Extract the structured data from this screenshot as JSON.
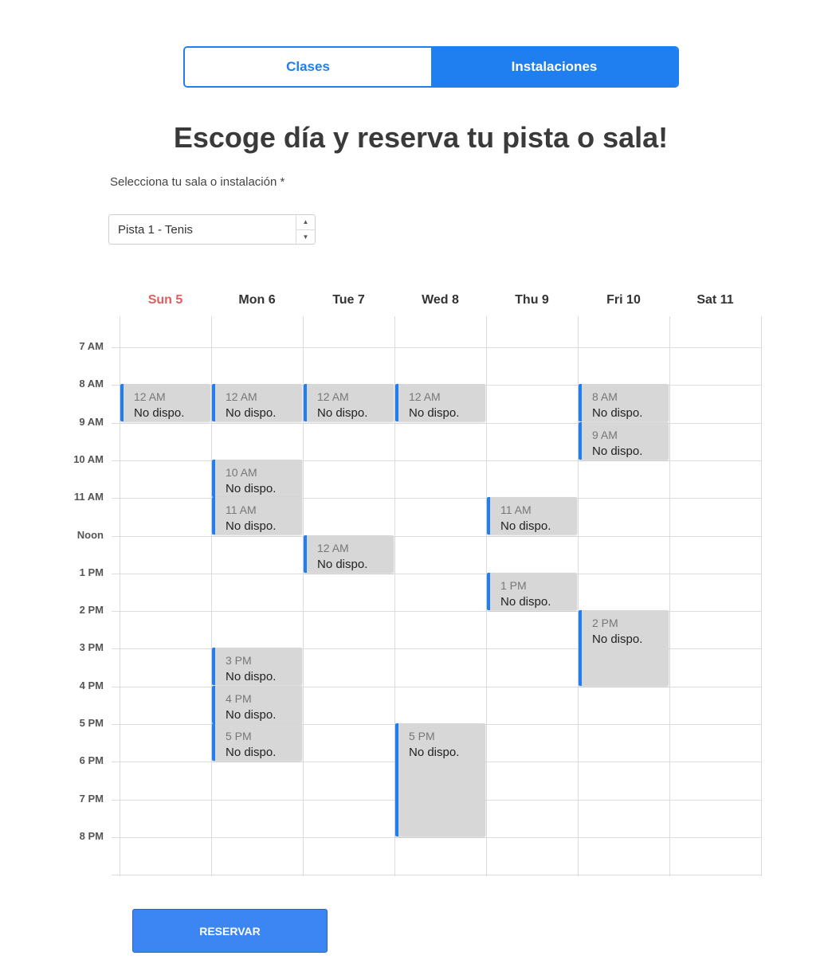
{
  "tabs": [
    {
      "label": "Clases",
      "active": false
    },
    {
      "label": "Instalaciones",
      "active": true
    }
  ],
  "heading": "Escoge día y reserva tu pista o sala!",
  "facility": {
    "label": "Selecciona tu sala o instalación *",
    "selected": "Pista 1 - Tenis"
  },
  "calendar": {
    "days": [
      {
        "label": "Sun 5",
        "today": true
      },
      {
        "label": "Mon 6",
        "today": false
      },
      {
        "label": "Tue 7",
        "today": false
      },
      {
        "label": "Wed 8",
        "today": false
      },
      {
        "label": "Thu 9",
        "today": false
      },
      {
        "label": "Fri 10",
        "today": false
      },
      {
        "label": "Sat 11",
        "today": false
      }
    ],
    "hours": [
      "7 AM",
      "8 AM",
      "9 AM",
      "10 AM",
      "11 AM",
      "Noon",
      "1 PM",
      "2 PM",
      "3 PM",
      "4 PM",
      "5 PM",
      "6 PM",
      "7 PM",
      "8 PM"
    ],
    "events": [
      {
        "day": 0,
        "start": 8,
        "end": 9,
        "time": "12 AM",
        "title": "No dispo."
      },
      {
        "day": 1,
        "start": 8,
        "end": 9,
        "time": "12 AM",
        "title": "No dispo."
      },
      {
        "day": 2,
        "start": 8,
        "end": 9,
        "time": "12 AM",
        "title": "No dispo."
      },
      {
        "day": 3,
        "start": 8,
        "end": 9,
        "time": "12 AM",
        "title": "No dispo."
      },
      {
        "day": 5,
        "start": 8,
        "end": 9,
        "time": "8 AM",
        "title": "No dispo."
      },
      {
        "day": 5,
        "start": 9,
        "end": 10,
        "time": "9 AM",
        "title": "No dispo."
      },
      {
        "day": 1,
        "start": 10,
        "end": 11,
        "time": "10 AM",
        "title": "No dispo."
      },
      {
        "day": 1,
        "start": 11,
        "end": 12,
        "time": "11 AM",
        "title": "No dispo."
      },
      {
        "day": 4,
        "start": 11,
        "end": 12,
        "time": "11 AM",
        "title": "No dispo."
      },
      {
        "day": 2,
        "start": 12,
        "end": 13,
        "time": "12 AM",
        "title": "No dispo."
      },
      {
        "day": 4,
        "start": 13,
        "end": 14,
        "time": "1 PM",
        "title": "No dispo."
      },
      {
        "day": 5,
        "start": 14,
        "end": 16,
        "time": "2 PM",
        "title": "No dispo."
      },
      {
        "day": 1,
        "start": 15,
        "end": 16,
        "time": "3 PM",
        "title": "No dispo."
      },
      {
        "day": 1,
        "start": 16,
        "end": 17,
        "time": "4 PM",
        "title": "No dispo."
      },
      {
        "day": 1,
        "start": 17,
        "end": 18,
        "time": "5 PM",
        "title": "No dispo."
      },
      {
        "day": 3,
        "start": 17,
        "end": 20,
        "time": "5 PM",
        "title": "No dispo."
      }
    ]
  },
  "reserve_label": "RESERVAR",
  "colors": {
    "accent": "#1f7ff0",
    "today": "#e35d5d",
    "event_bg": "#d7d7d7"
  }
}
